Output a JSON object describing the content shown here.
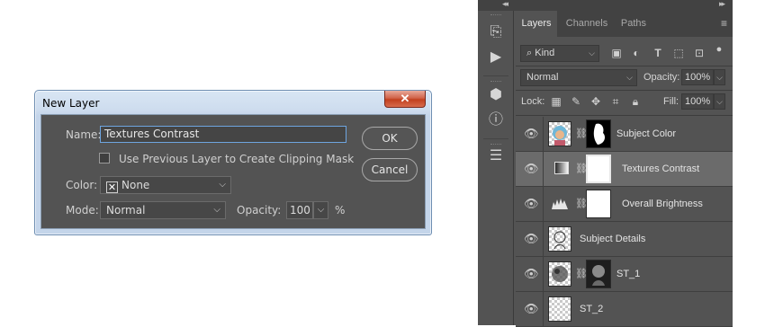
{
  "dialog": {
    "title": "New Layer",
    "close_label": "✕",
    "name_label": "Name:",
    "name_value": "Textures Contrast",
    "clipping_label": "Use Previous Layer to Create Clipping Mask",
    "color_label": "Color:",
    "color_value": "None",
    "mode_label": "Mode:",
    "mode_value": "Normal",
    "opacity_label": "Opacity:",
    "opacity_value": "100",
    "opacity_unit": "%",
    "ok_label": "OK",
    "cancel_label": "Cancel"
  },
  "panel": {
    "tabs": [
      "Layers",
      "Channels",
      "Paths"
    ],
    "active_tab": "Layers",
    "kind_filter": "Kind",
    "blend_mode": "Normal",
    "opacity_label": "Opacity:",
    "opacity_value": "100%",
    "lock_label": "Lock:",
    "fill_label": "Fill:",
    "fill_value": "100%",
    "layers": [
      {
        "name": "Subject Color",
        "visible": true,
        "has_mask": true,
        "selected": false,
        "type": "pixel-color"
      },
      {
        "name": "Textures Contrast",
        "visible": true,
        "has_mask": true,
        "selected": true,
        "type": "adjustment-gradient"
      },
      {
        "name": "Overall Brightness",
        "visible": true,
        "has_mask": true,
        "selected": false,
        "type": "adjustment-levels"
      },
      {
        "name": "Subject Details",
        "visible": true,
        "has_mask": false,
        "selected": false,
        "type": "pixel-sketch"
      },
      {
        "name": "ST_1",
        "visible": true,
        "has_mask": true,
        "selected": false,
        "type": "pixel-texture"
      },
      {
        "name": "ST_2",
        "visible": true,
        "has_mask": false,
        "selected": false,
        "type": "pixel-transparent"
      }
    ]
  },
  "colors": {
    "dialog_body": "#535353",
    "panel_bg": "#535353",
    "selected_row": "#6b6b6b",
    "focus_border": "#6ea5e0",
    "close_button": "#c2401f"
  }
}
